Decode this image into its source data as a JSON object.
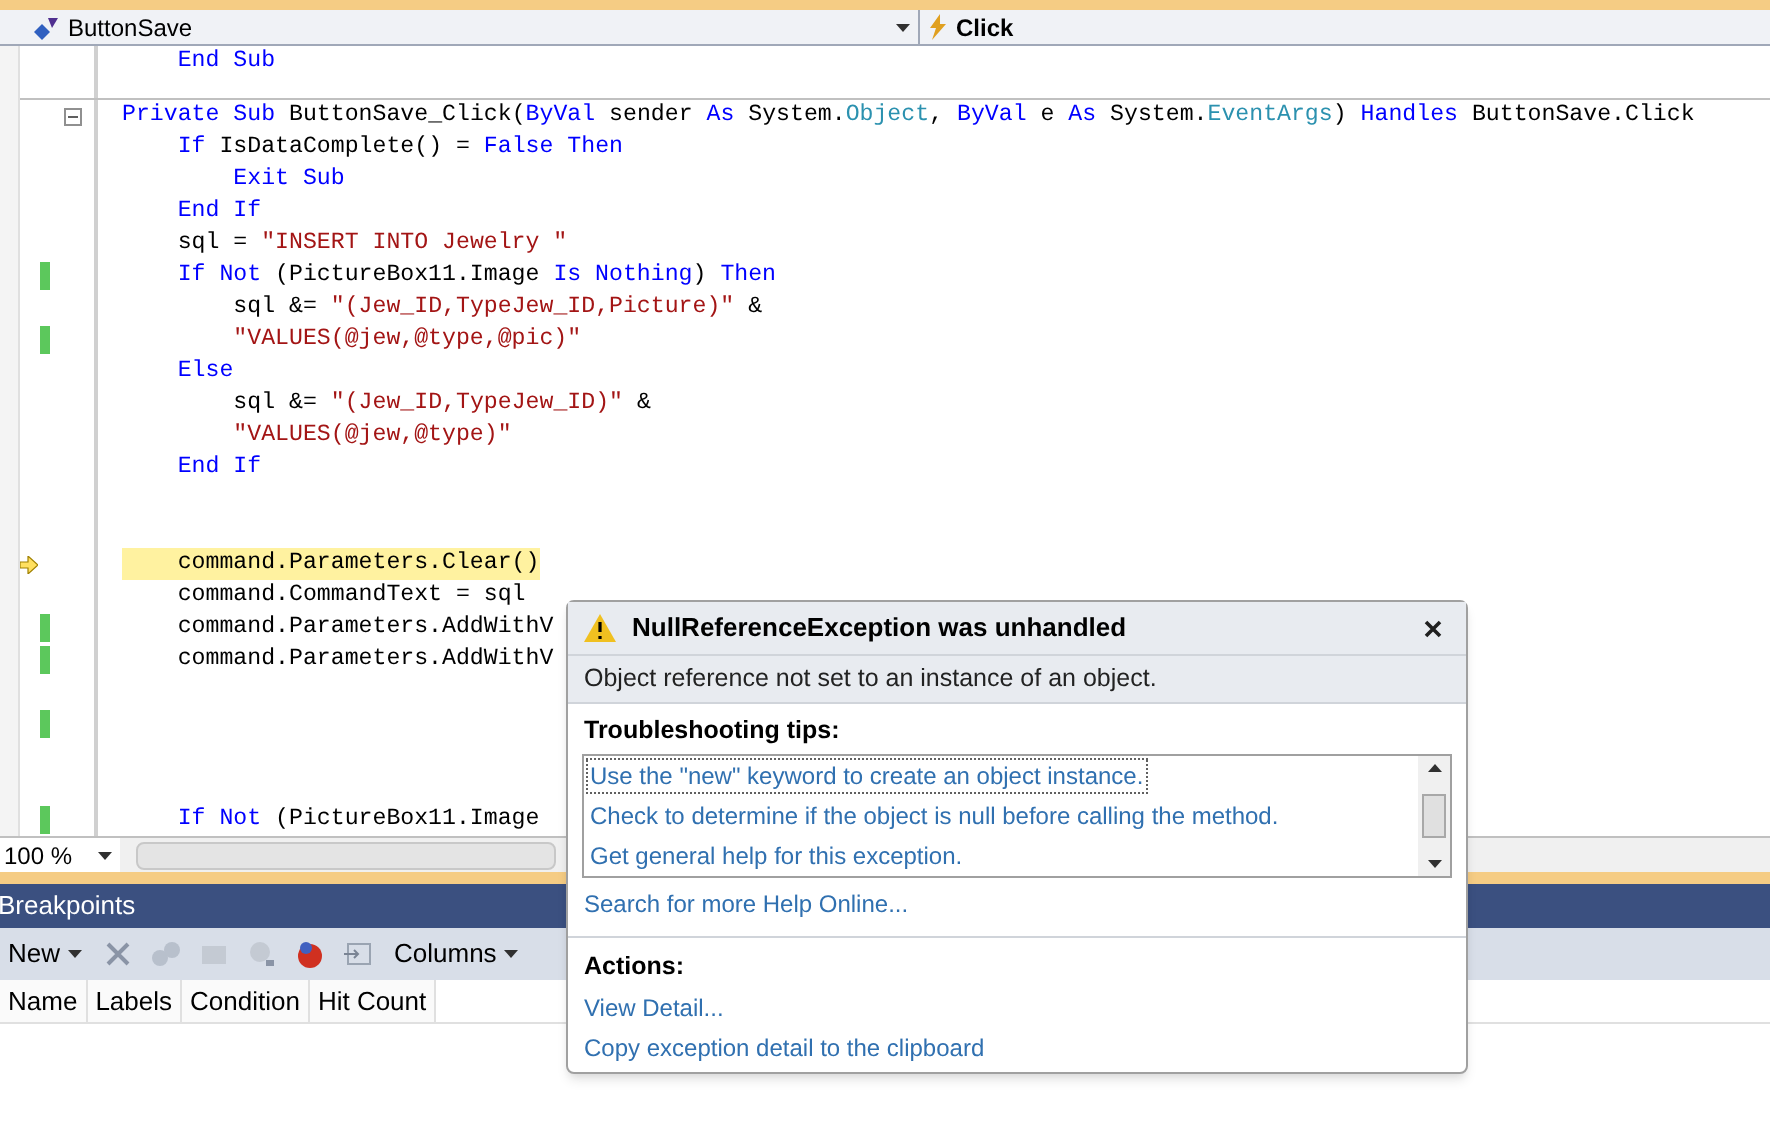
{
  "navigation_bar": {
    "class_dropdown": "ButtonSave",
    "member_dropdown": "Click"
  },
  "code_lines": [
    {
      "kind": "code",
      "tokens": [
        {
          "kind": "kw",
          "text": "    End Sub"
        }
      ]
    },
    {
      "kind": "separator"
    },
    {
      "kind": "code",
      "collapse": true,
      "tokens": [
        {
          "kind": "kw",
          "text": "Private Sub "
        },
        {
          "kind": "plain",
          "text": "ButtonSave_Click("
        },
        {
          "kind": "kw",
          "text": "ByVal "
        },
        {
          "kind": "plain",
          "text": "sender "
        },
        {
          "kind": "kw",
          "text": "As "
        },
        {
          "kind": "plain",
          "text": "System."
        },
        {
          "kind": "type",
          "text": "Object"
        },
        {
          "kind": "plain",
          "text": ", "
        },
        {
          "kind": "kw",
          "text": "ByVal "
        },
        {
          "kind": "plain",
          "text": "e "
        },
        {
          "kind": "kw",
          "text": "As "
        },
        {
          "kind": "plain",
          "text": "System."
        },
        {
          "kind": "type",
          "text": "EventArgs"
        },
        {
          "kind": "plain",
          "text": ") "
        },
        {
          "kind": "kw",
          "text": "Handles "
        },
        {
          "kind": "plain",
          "text": "ButtonSave.Click"
        }
      ]
    },
    {
      "kind": "code",
      "tokens": [
        {
          "kind": "kw",
          "text": "    If "
        },
        {
          "kind": "plain",
          "text": "IsDataComplete() = "
        },
        {
          "kind": "kw",
          "text": "False Then"
        }
      ]
    },
    {
      "kind": "code",
      "tokens": [
        {
          "kind": "kw",
          "text": "        Exit Sub"
        }
      ]
    },
    {
      "kind": "code",
      "tokens": [
        {
          "kind": "kw",
          "text": "    End If"
        }
      ]
    },
    {
      "kind": "code",
      "tokens": [
        {
          "kind": "plain",
          "text": "    sql = "
        },
        {
          "kind": "str",
          "text": "\"INSERT INTO Jewelry \""
        }
      ]
    },
    {
      "kind": "code",
      "changed": true,
      "tokens": [
        {
          "kind": "kw",
          "text": "    If Not "
        },
        {
          "kind": "plain",
          "text": "(PictureBox11.Image "
        },
        {
          "kind": "kw",
          "text": "Is Nothing"
        },
        {
          "kind": "plain",
          "text": ") "
        },
        {
          "kind": "kw",
          "text": "Then"
        }
      ]
    },
    {
      "kind": "code",
      "tokens": [
        {
          "kind": "plain",
          "text": "        sql &= "
        },
        {
          "kind": "str",
          "text": "\"(Jew_ID,TypeJew_ID,Picture)\""
        },
        {
          "kind": "plain",
          "text": " &"
        }
      ]
    },
    {
      "kind": "code",
      "changed": true,
      "tokens": [
        {
          "kind": "str",
          "text": "        \"VALUES(@jew,@type,@pic)\""
        }
      ]
    },
    {
      "kind": "code",
      "tokens": [
        {
          "kind": "kw",
          "text": "    Else"
        }
      ]
    },
    {
      "kind": "code",
      "tokens": [
        {
          "kind": "plain",
          "text": "        sql &= "
        },
        {
          "kind": "str",
          "text": "\"(Jew_ID,TypeJew_ID)\""
        },
        {
          "kind": "plain",
          "text": " &"
        }
      ]
    },
    {
      "kind": "code",
      "tokens": [
        {
          "kind": "str",
          "text": "        \"VALUES(@jew,@type)\""
        }
      ]
    },
    {
      "kind": "code",
      "tokens": [
        {
          "kind": "kw",
          "text": "    End If"
        }
      ]
    },
    {
      "kind": "blank"
    },
    {
      "kind": "blank"
    },
    {
      "kind": "code",
      "current": true,
      "tokens": [
        {
          "kind": "plain",
          "text": "    command.Parameters.Clear()"
        }
      ]
    },
    {
      "kind": "code",
      "tokens": [
        {
          "kind": "plain",
          "text": "    command.CommandText = sql"
        }
      ]
    },
    {
      "kind": "code",
      "changed": true,
      "tokens": [
        {
          "kind": "plain",
          "text": "    command.Parameters.AddWithV"
        }
      ]
    },
    {
      "kind": "code",
      "changed": true,
      "tokens": [
        {
          "kind": "plain",
          "text": "    command.Parameters.AddWithV"
        }
      ]
    },
    {
      "kind": "blank"
    },
    {
      "kind": "blank",
      "changed": true
    },
    {
      "kind": "blank"
    },
    {
      "kind": "blank"
    },
    {
      "kind": "code",
      "changed": true,
      "tokens": [
        {
          "kind": "kw",
          "text": "    If Not "
        },
        {
          "kind": "plain",
          "text": "(PictureBox11.Image"
        }
      ]
    }
  ],
  "zoom": "100 %",
  "breakpoints": {
    "title": "Breakpoints",
    "toolbar": [
      {
        "kind": "menu",
        "label": "New"
      },
      {
        "kind": "icon"
      },
      {
        "kind": "icon"
      },
      {
        "kind": "icon"
      },
      {
        "kind": "icon"
      },
      {
        "kind": "icon"
      },
      {
        "kind": "icon"
      },
      {
        "kind": "menu",
        "label": "Columns"
      }
    ],
    "columns": [
      "Name",
      "Labels",
      "Condition",
      "Hit Count"
    ]
  },
  "exception": {
    "title": "NullReferenceException was unhandled",
    "message": "Object reference not set to an instance of an object.",
    "tips_heading": "Troubleshooting tips:",
    "tips": [
      {
        "text": "Use the \"new\" keyword to create an object instance.",
        "selected": true
      },
      {
        "text": "Check to determine if the object is null before calling the method.",
        "selected": false
      },
      {
        "text": "Get general help for this exception.",
        "selected": false
      }
    ],
    "search_link": "Search for more Help Online...",
    "actions_heading": "Actions:",
    "actions": [
      "View Detail...",
      "Copy exception detail to the clipboard"
    ]
  }
}
